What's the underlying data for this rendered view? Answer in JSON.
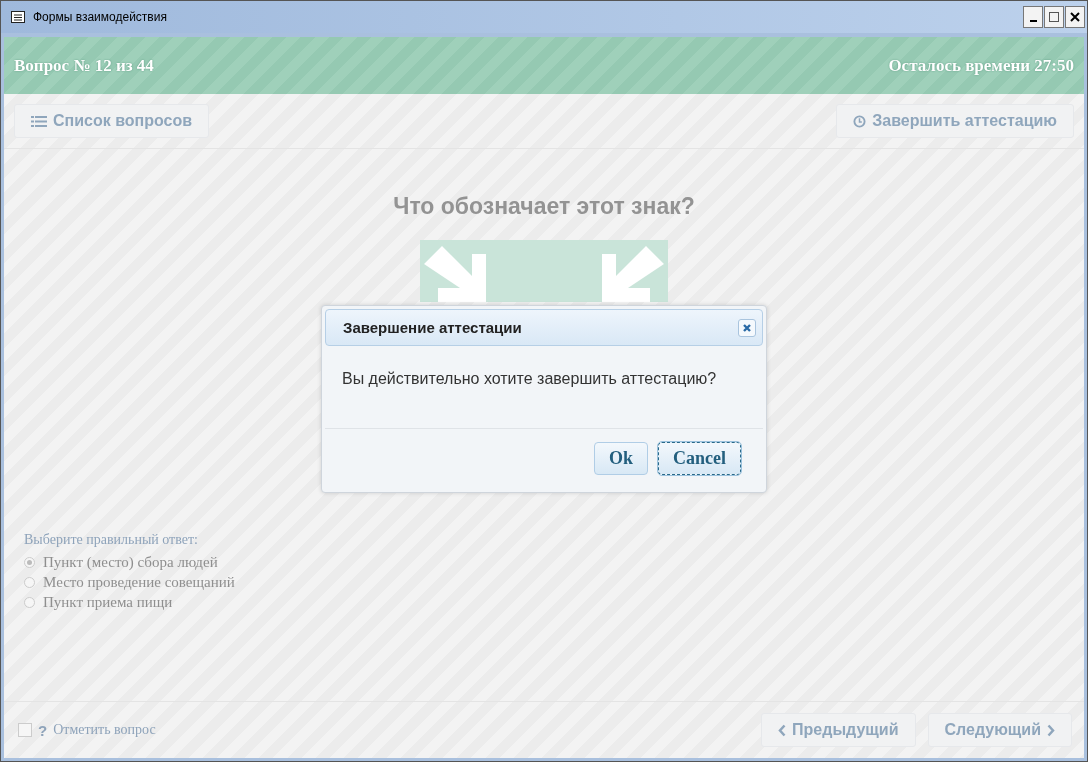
{
  "window": {
    "title": "Формы взаимодействия"
  },
  "header": {
    "question_counter": "Вопрос № 12 из 44",
    "time_left": "Осталось времени 27:50"
  },
  "toolbar": {
    "list_button": "Список вопросов",
    "finish_button": "Завершить аттестацию"
  },
  "question": {
    "text": "Что обозначает этот знак?"
  },
  "answers": {
    "prompt": "Выберите правильный ответ:",
    "options": [
      {
        "label": "Пункт (место) сбора людей",
        "selected": true
      },
      {
        "label": "Место проведение совещаний",
        "selected": false
      },
      {
        "label": "Пункт приема пищи",
        "selected": false
      }
    ]
  },
  "footer": {
    "mark_checked": false,
    "mark_icon": "?",
    "mark_label": "Отметить вопрос",
    "prev_button": "Предыдущий",
    "next_button": "Следующий"
  },
  "dialog": {
    "title": "Завершение аттестации",
    "message": "Вы действительно хотите завершить аттестацию?",
    "buttons": [
      {
        "label": "Ok",
        "selected": false
      },
      {
        "label": "Cancel",
        "selected": true
      }
    ]
  }
}
